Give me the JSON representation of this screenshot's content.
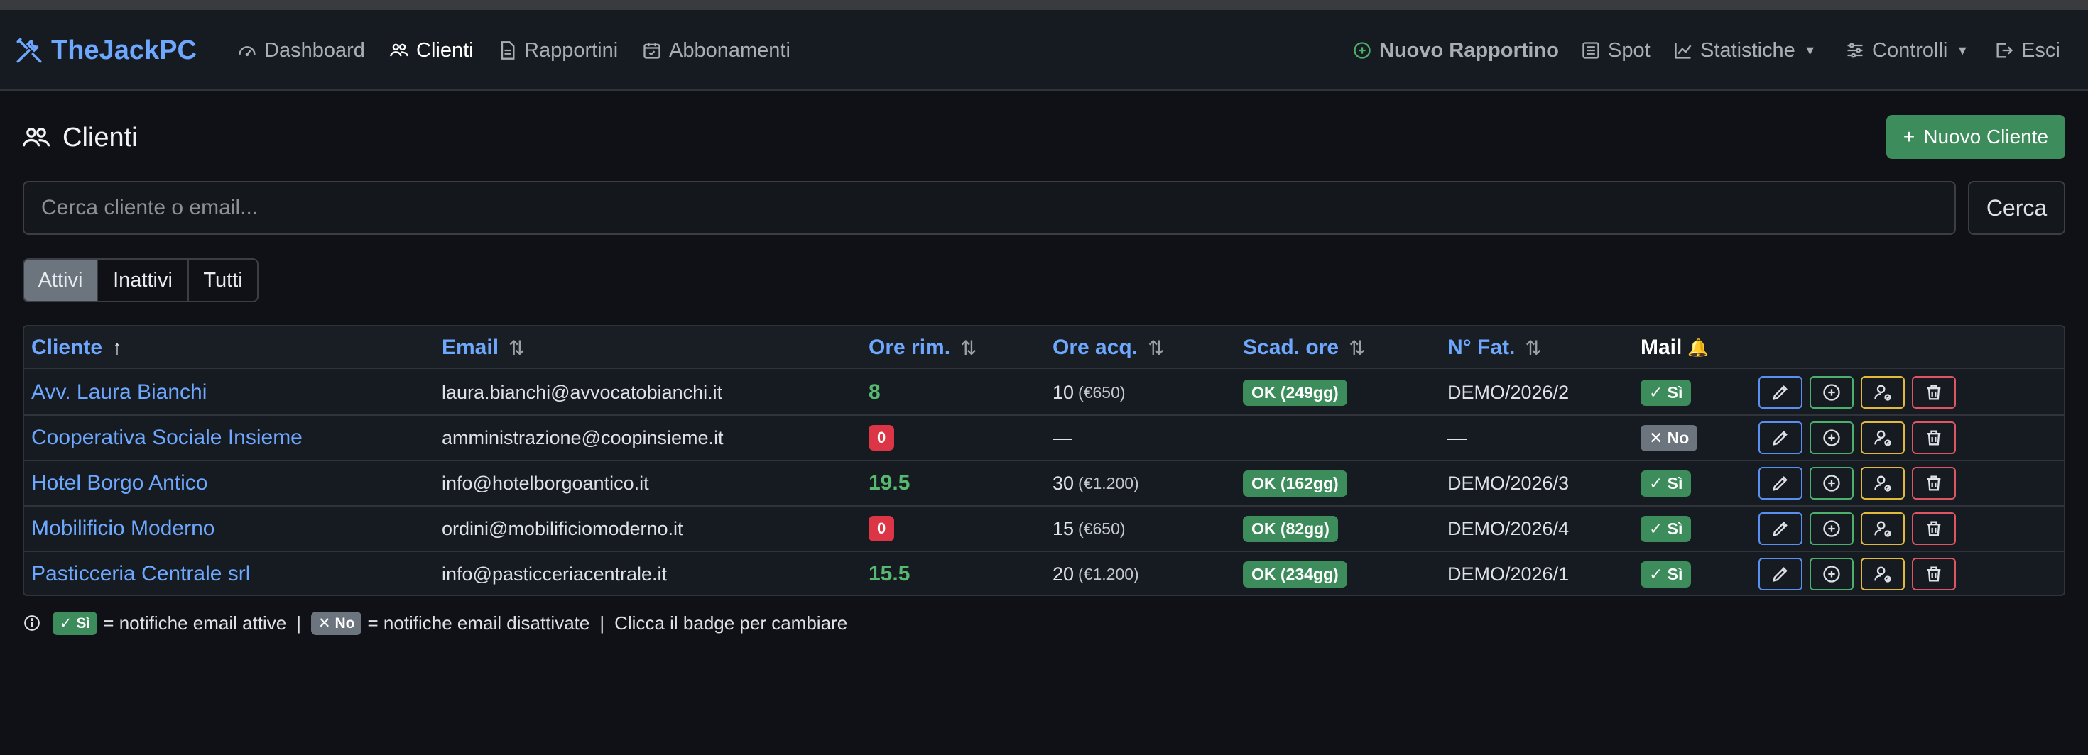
{
  "app": {
    "brand": "TheJackPC"
  },
  "nav": {
    "dashboard": "Dashboard",
    "clienti": "Clienti",
    "rapportini": "Rapportini",
    "abbonamenti": "Abbonamenti",
    "nuovo_rapportino": "Nuovo Rapportino",
    "spot": "Spot",
    "statistiche": "Statistiche",
    "controlli": "Controlli",
    "esci": "Esci"
  },
  "page": {
    "title": "Clienti",
    "new_button": "Nuovo Cliente",
    "search_placeholder": "Cerca cliente o email...",
    "search_button": "Cerca"
  },
  "filters": [
    "Attivi",
    "Inattivi",
    "Tutti"
  ],
  "active_filter": "Attivi",
  "table": {
    "headers": {
      "cliente": "Cliente",
      "email": "Email",
      "ore_rim": "Ore rim.",
      "ore_acq": "Ore acq.",
      "scad_ore": "Scad. ore",
      "n_fat": "N° Fat.",
      "mail": "Mail"
    },
    "rows": [
      {
        "cliente": "Avv. Laura Bianchi",
        "email": "laura.bianchi@avvocatobianchi.it",
        "ore_rim": "8",
        "ore_rim_status": "positive",
        "ore_acq": "10",
        "ore_acq_price": "(€650)",
        "scad": "OK (249gg)",
        "fat": "DEMO/2026/2",
        "mail": "✓ Sì",
        "mail_on": true
      },
      {
        "cliente": "Cooperativa Sociale Insieme",
        "email": "amministrazione@coopinsieme.it",
        "ore_rim": "0",
        "ore_rim_status": "zero",
        "ore_acq": "—",
        "ore_acq_price": "",
        "scad": "",
        "fat": "—",
        "mail": "✕ No",
        "mail_on": false
      },
      {
        "cliente": "Hotel Borgo Antico",
        "email": "info@hotelborgoantico.it",
        "ore_rim": "19.5",
        "ore_rim_status": "positive",
        "ore_acq": "30",
        "ore_acq_price": "(€1.200)",
        "scad": "OK (162gg)",
        "fat": "DEMO/2026/3",
        "mail": "✓ Sì",
        "mail_on": true
      },
      {
        "cliente": "Mobilificio Moderno",
        "email": "ordini@mobilificiomoderno.it",
        "ore_rim": "0",
        "ore_rim_status": "zero",
        "ore_acq": "15",
        "ore_acq_price": "(€650)",
        "scad": "OK (82gg)",
        "fat": "DEMO/2026/4",
        "mail": "✓ Sì",
        "mail_on": true
      },
      {
        "cliente": "Pasticceria Centrale srl",
        "email": "info@pasticceriacentrale.it",
        "ore_rim": "15.5",
        "ore_rim_status": "positive",
        "ore_acq": "20",
        "ore_acq_price": "(€1.200)",
        "scad": "OK (234gg)",
        "fat": "DEMO/2026/1",
        "mail": "✓ Sì",
        "mail_on": true
      }
    ]
  },
  "legend": {
    "si_badge": "✓ Sì",
    "si_text": "= notifiche email attive",
    "sep": "|",
    "no_badge": "✕ No",
    "no_text": "= notifiche email disattivate",
    "hint": "Clicca il badge per cambiare"
  },
  "colors": {
    "accent_blue": "#6ea8fe",
    "success": "#3d8c5b",
    "danger": "#dc3545",
    "warning": "#e3b93a",
    "secondary": "#6c757d"
  }
}
